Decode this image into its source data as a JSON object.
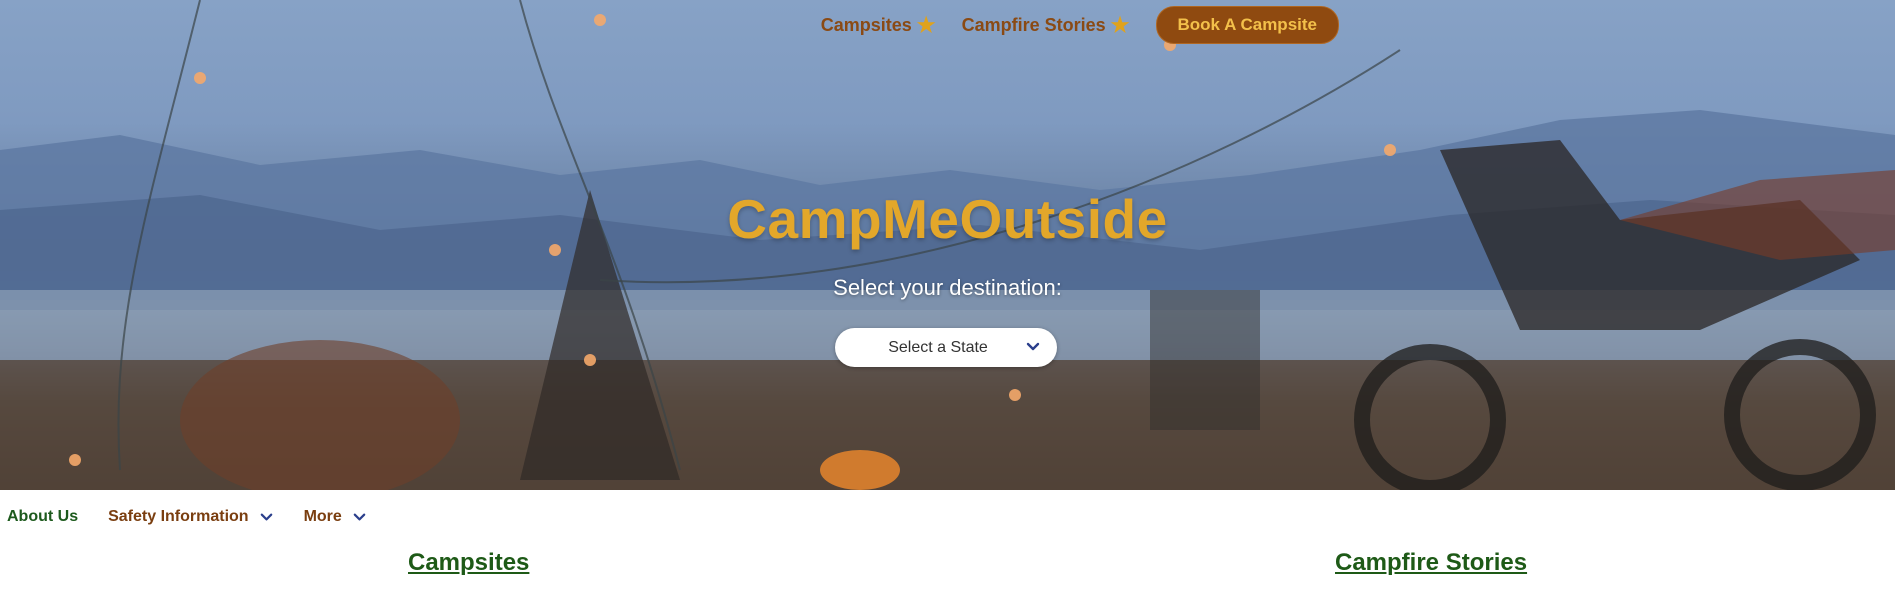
{
  "colors": {
    "brand_gold": "#e3a72a",
    "nav_brown": "#8a4a14",
    "button_bg": "#8f4a10",
    "button_text": "#f3c04a",
    "heading_green": "#1e5a17",
    "chevron_blue": "#2b3f8c"
  },
  "top_nav": {
    "campsites_label": "Campsites",
    "campfire_stories_label": "Campfire Stories",
    "book_button_label": "Book A Campsite",
    "icon": "star-icon"
  },
  "hero": {
    "title": "CampMeOutside",
    "subtitle": "Select your destination:",
    "state_select": {
      "selected": "Select a State",
      "icon": "chevron-down-icon"
    }
  },
  "secondary_nav": {
    "items": [
      {
        "label": "About Us"
      },
      {
        "label": "Safety Information",
        "icon": "chevron-down-icon"
      },
      {
        "label": "More",
        "icon": "chevron-down-icon"
      }
    ]
  },
  "sections": {
    "campsites_heading": "Campsites",
    "campfire_stories_heading": "Campfire Stories"
  }
}
